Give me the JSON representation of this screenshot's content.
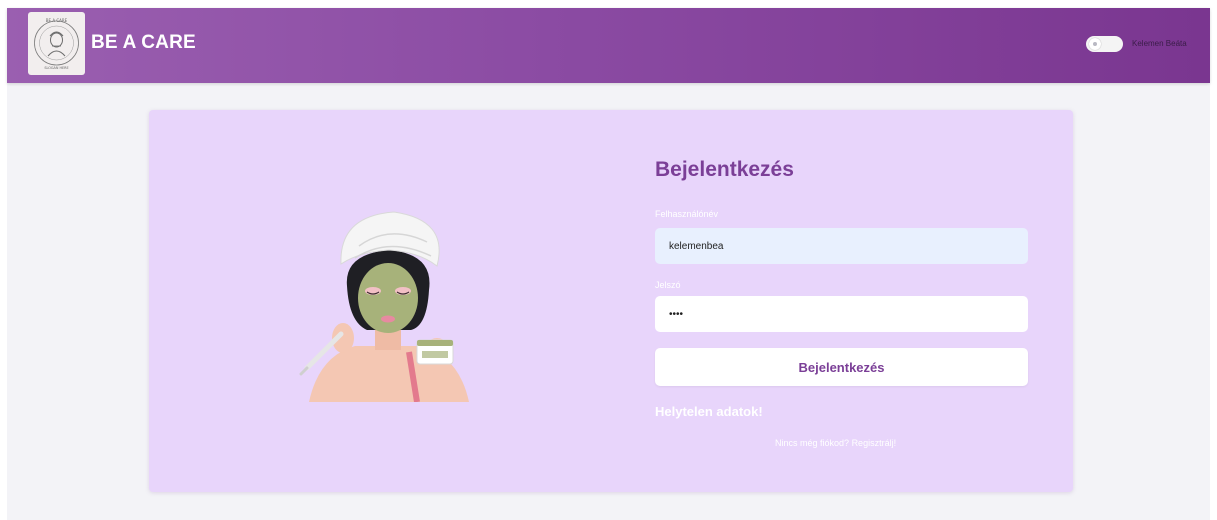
{
  "header": {
    "brand": "BE A CARE",
    "logo_text": "BE A CARE · SLOGAN HERE",
    "toggle": {
      "state": "off"
    },
    "user_name": "Kelemen Beáta"
  },
  "login": {
    "title": "Bejelentkezés",
    "username_label": "Felhasználónév",
    "username_value": "kelemenbea",
    "password_label": "Jelszó",
    "password_value": "••••",
    "submit_label": "Bejelentkezés",
    "error_message": "Helytelen adatok!",
    "register_prompt": "Nincs még fiókod?",
    "register_link": "Regisztrálj!"
  },
  "illustration": {
    "icon": "woman-face-mask-illustration"
  },
  "colors": {
    "header_start": "#9a5fb0",
    "header_end": "#7a3690",
    "card_background": "#e8d5fb",
    "accent": "#7b3f97",
    "page_background": "#f3f3f7"
  }
}
